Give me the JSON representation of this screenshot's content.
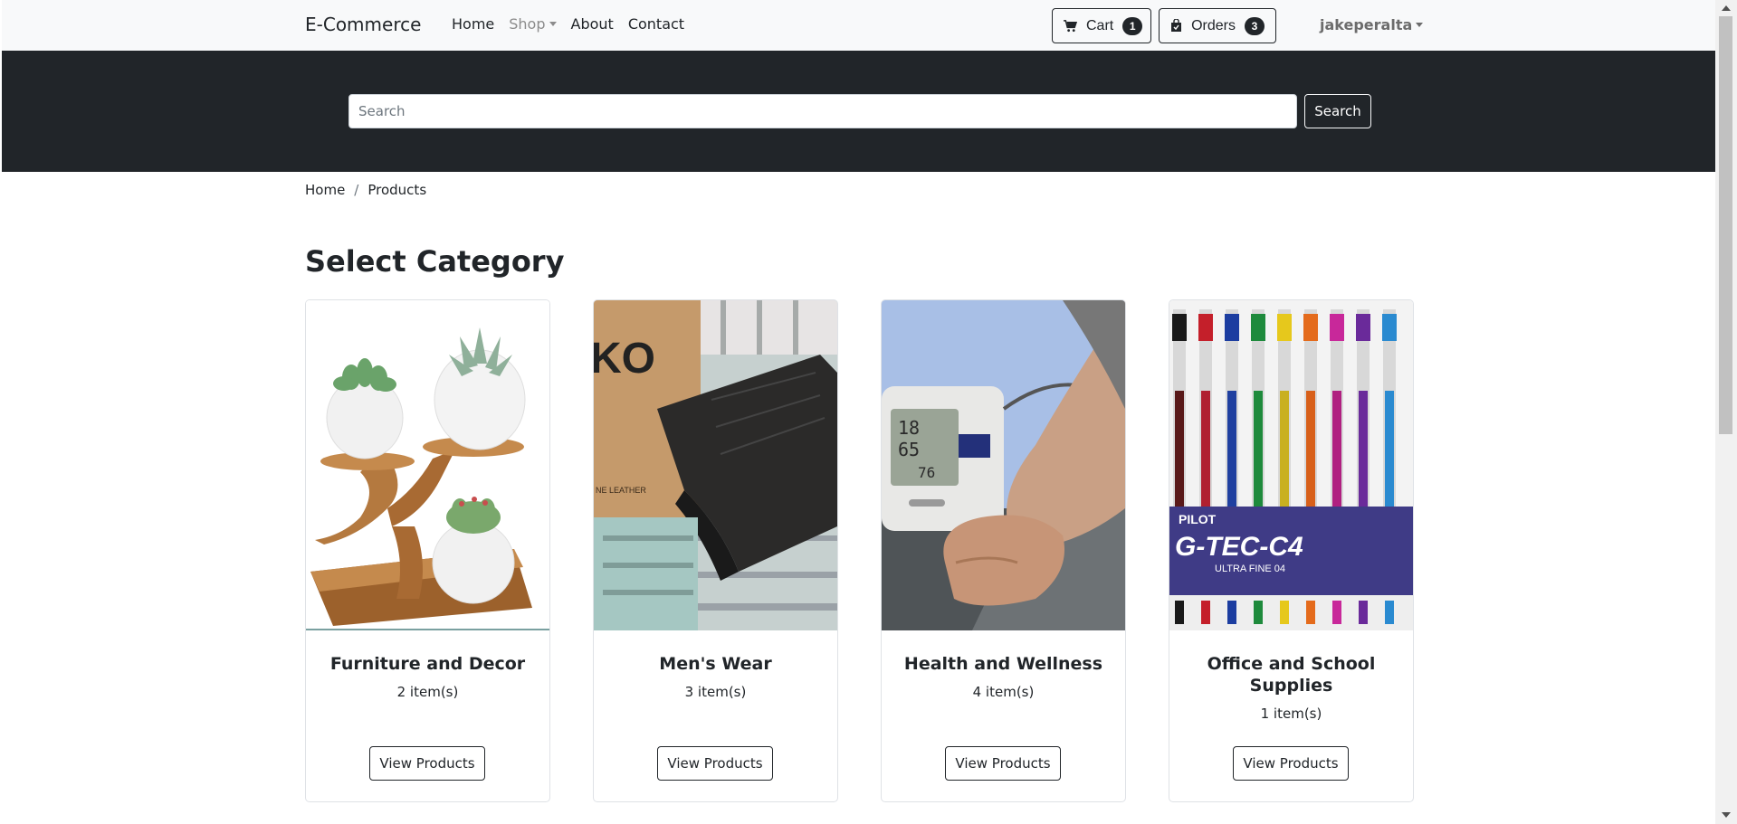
{
  "navbar": {
    "brand": "E-Commerce",
    "links": [
      {
        "label": "Home"
      },
      {
        "label": "Shop"
      },
      {
        "label": "About"
      },
      {
        "label": "Contact"
      }
    ],
    "cart": {
      "label": "Cart",
      "count": "1",
      "icon": "cart-icon"
    },
    "orders": {
      "label": "Orders",
      "count": "3",
      "icon": "bag-check-icon"
    },
    "user": "jakeperalta"
  },
  "search": {
    "placeholder": "Search",
    "button": "Search"
  },
  "breadcrumb": {
    "home": "Home",
    "current": "Products"
  },
  "heading": "Select Category",
  "categories": [
    {
      "title": "Furniture and Decor",
      "count": "2 item(s)",
      "button": "View Products"
    },
    {
      "title": "Men's Wear",
      "count": "3 item(s)",
      "button": "View Products"
    },
    {
      "title": "Health and Wellness",
      "count": "4 item(s)",
      "button": "View Products"
    },
    {
      "title": "Office and School Supplies",
      "count": "1 item(s)",
      "button": "View Products"
    }
  ],
  "pen_brand": "PILOT",
  "pen_model": "G-TEC-C4",
  "pen_sub": "ULTRA FINE 04",
  "colors": {
    "dark": "#212529",
    "light": "#f8f9fa"
  }
}
